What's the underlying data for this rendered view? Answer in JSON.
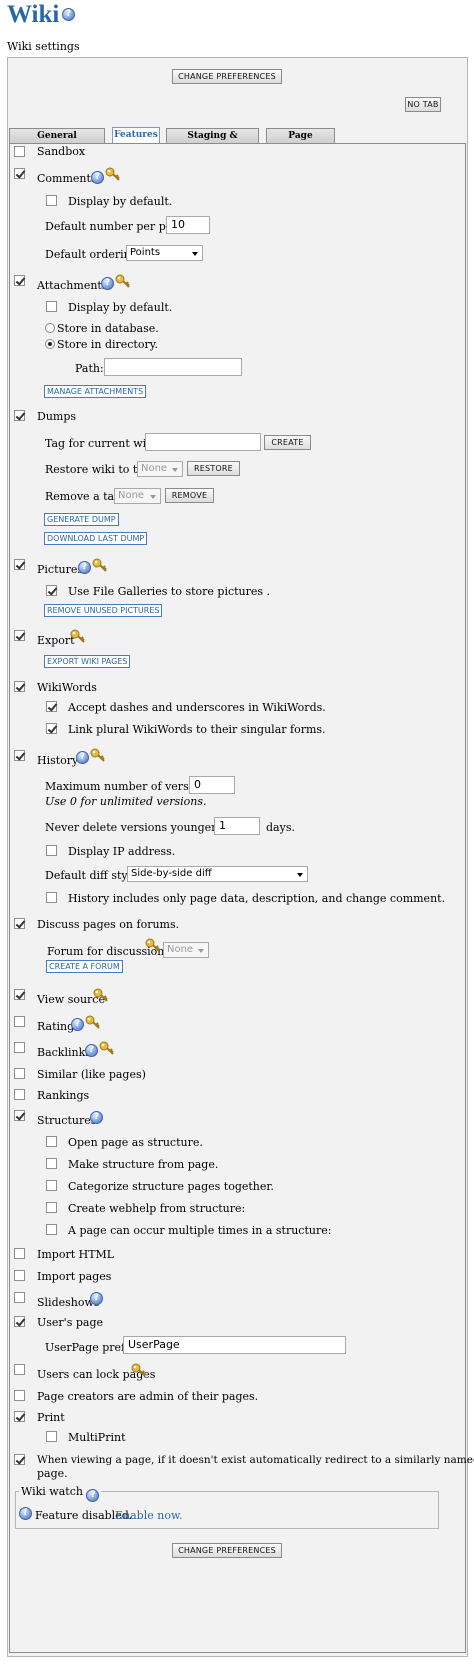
{
  "page": {
    "title": "Wiki",
    "subtitle": "Wiki settings"
  },
  "buttons": {
    "change_prefs_top": "CHANGE PREFERENCES",
    "change_prefs_bottom": "CHANGE PREFERENCES",
    "no_tab": "NO TAB"
  },
  "tabs": [
    "General Preferences",
    "Features",
    "Staging & Approval",
    "Page Listings"
  ],
  "features": {
    "sandbox": "Sandbox",
    "comments": "Comments",
    "comments_display": "Display by default.",
    "comments_per_page_label": "Default number per page:",
    "comments_per_page_value": "10",
    "comments_ordering_label": "Default ordering:",
    "comments_ordering_value": "Points",
    "attachments": "Attachments",
    "attachments_display": "Display by default.",
    "store_db": "Store in database.",
    "store_dir": "Store in directory.",
    "path_label": "Path:",
    "manage_attachments": "MANAGE ATTACHMENTS",
    "dumps": "Dumps",
    "tag_current_label": "Tag for current wiki:",
    "create": "CREATE",
    "restore_label": "Restore wiki to tag:",
    "restore_value": "None",
    "restore_btn": "RESTORE",
    "remove_label": "Remove a tag:",
    "remove_value": "None",
    "remove_btn": "REMOVE",
    "generate_dump": "GENERATE DUMP",
    "download_dump": "DOWNLOAD LAST DUMP",
    "pictures": "Pictures",
    "file_galleries": "Use File Galleries to store pictures .",
    "remove_unused": "REMOVE UNUSED PICTURES",
    "export": "Export",
    "export_pages": "EXPORT WIKI PAGES",
    "wikiwords": "WikiWords",
    "accept_dashes": "Accept dashes and underscores in WikiWords.",
    "link_plural": "Link plural WikiWords to their singular forms.",
    "history": "History",
    "max_versions_label": "Maximum number of versions:",
    "max_versions_value": "0",
    "max_versions_note": "Use 0 for unlimited versions.",
    "never_delete_label": "Never delete versions younger than:",
    "never_delete_value": "1",
    "days": "days.",
    "display_ip": "Display IP address.",
    "diff_style_label": "Default diff style:",
    "diff_style_value": "Side-by-side diff",
    "history_only": "History includes only page data, description, and change comment.",
    "discuss": "Discuss pages on forums.",
    "forum_label": "Forum for discussion:",
    "forum_value": "None",
    "create_forum": "CREATE A FORUM",
    "view_source": "View source",
    "rating": "Rating",
    "backlinks": "Backlinks",
    "similar": "Similar (like pages)",
    "rankings": "Rankings",
    "structures": "Structures",
    "open_structure": "Open page as structure.",
    "make_structure": "Make structure from page.",
    "categorize": "Categorize structure pages together.",
    "webhelp": "Create webhelp from structure:",
    "multiple_times": "A page can occur multiple times in a structure:",
    "import_html": "Import HTML",
    "import_pages": "Import pages",
    "slideshows": "Slideshows",
    "users_page": "User's page",
    "userpage_prefix_label": "UserPage prefix:",
    "userpage_prefix_value": "UserPage",
    "users_lock": "Users can lock pages",
    "creators_admin": "Page creators are admin of their pages.",
    "print": "Print",
    "multiprint": "MultiPrint",
    "redirect": "When viewing a page, if it doesn't exist automatically redirect to a similarly named",
    "redirect2": "page."
  },
  "wiki_watch": {
    "legend": "Wiki watch",
    "status": "Feature disabled.",
    "enable": "Enable now."
  },
  "colors": {
    "accent": "#2b67a8",
    "panel": "#f2f2f2"
  },
  "icons": [
    "help-icon",
    "key-icon",
    "info-icon"
  ]
}
